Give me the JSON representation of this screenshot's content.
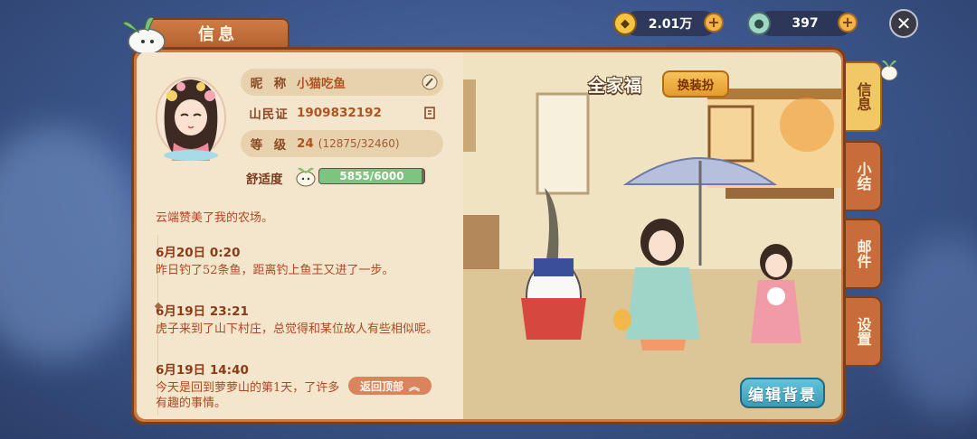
{
  "top_bar": {
    "coins": {
      "value": "2.01万",
      "icon": "copper-coin-icon"
    },
    "jade": {
      "value": "397",
      "icon": "jade-icon"
    },
    "close_icon": "close-icon"
  },
  "header": {
    "title": "信息"
  },
  "profile": {
    "nickname_label": "昵  称",
    "nickname": "小猫吃鱼",
    "id_label": "山民证",
    "id_value": "1909832192",
    "level_label": "等  级",
    "level": "24",
    "level_exp": "(12875/32460)",
    "comfort_label": "舒适度",
    "comfort_text": "5855/6000",
    "comfort_fraction": 0.9758
  },
  "log": {
    "partial_text": "云端赞美了我的农场。",
    "entries": [
      {
        "time": "6月20日 0:20",
        "text": "昨日钓了52条鱼，距离钓上鱼王又进了一步。"
      },
      {
        "time": "6月19日 23:21",
        "text": "虎子来到了山下村庄，总觉得和某位故人有些相似呢。"
      },
      {
        "time": "6月19日 14:40",
        "text": "今天是回到萝萝山的第1天，了许多有趣的事情。"
      }
    ],
    "back_top": "返回顶部"
  },
  "scene": {
    "title": "全家福",
    "dressup_button": "换装扮",
    "edit_bg_button": "编辑背景"
  },
  "side_tabs": [
    {
      "label": "信息",
      "active": true
    },
    {
      "label": "小结",
      "active": false
    },
    {
      "label": "邮件",
      "active": false
    },
    {
      "label": "设置",
      "active": false
    }
  ],
  "colors": {
    "panel": "#c77a45",
    "card": "#f3e6cc",
    "accent_text": "#b0531e",
    "active_tab": "#f2c766"
  }
}
